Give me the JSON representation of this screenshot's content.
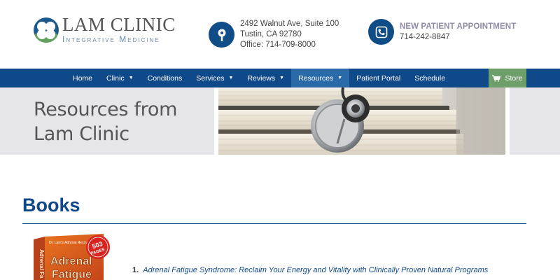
{
  "header": {
    "logo_title": "LAM CLINIC",
    "logo_subtitle": "Integrative Medicine",
    "address": {
      "line1": "2492 Walnut Ave, Suite 100",
      "line2": "Tustin, CA 92780",
      "line3": "Office: 714-709-8000"
    },
    "appointment": {
      "title": "NEW PATIENT APPOINTMENT",
      "phone": "714-242-8847"
    }
  },
  "nav": {
    "items": [
      {
        "label": "Home"
      },
      {
        "label": "Clinic"
      },
      {
        "label": "Conditions"
      },
      {
        "label": "Services"
      },
      {
        "label": "Reviews"
      },
      {
        "label": "Resources"
      },
      {
        "label": "Patient Portal"
      },
      {
        "label": "Schedule"
      }
    ],
    "store_label": "Store"
  },
  "banner": {
    "title_line1": "Resources from",
    "title_line2": "Lam Clinic"
  },
  "content": {
    "section_title": "Books",
    "book_badge_top": "503",
    "book_badge_bottom": "PAGES",
    "book_cover_title_1": "Adrenal",
    "book_cover_title_2": "Fatigue",
    "book_cover_series": "Dr. Lam's Adrenal Recovery Series",
    "book_cover_spine": "Adrenal Fa",
    "books": [
      {
        "number": "1.",
        "title": "Adrenal Fatigue Syndrome: Reclaim Your Energy and Vitality with Clinically Proven Natural Programs"
      }
    ]
  },
  "colors": {
    "primary": "#10498a",
    "nav_active": "#2a6aa8",
    "store": "#6e9f6b",
    "appointment_title": "#8f8aa6",
    "banner_bg": "#e6e5ea"
  }
}
